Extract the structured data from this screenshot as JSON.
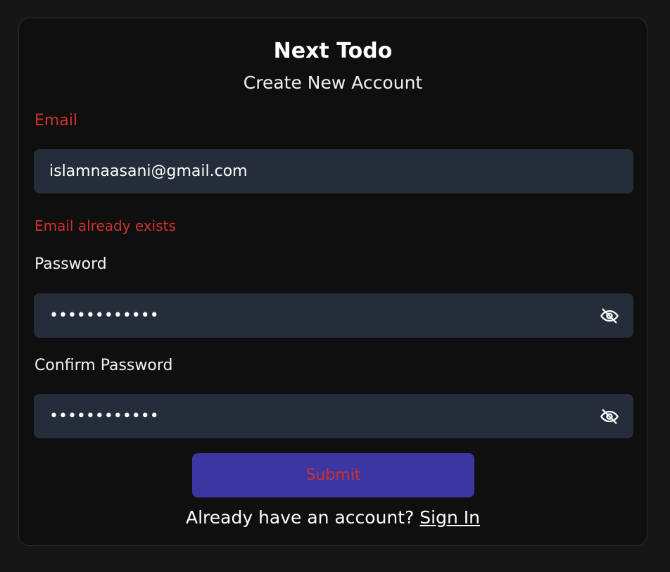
{
  "header": {
    "app_title": "Next Todo",
    "subtitle": "Create New Account"
  },
  "form": {
    "email": {
      "label": "Email",
      "value": "islamnaasani@gmail.com",
      "error": "Email already exists"
    },
    "password": {
      "label": "Password",
      "masked_value": "••••••••••••",
      "toggle_icon": "eye-off-icon"
    },
    "confirm_password": {
      "label": "Confirm Password",
      "masked_value": "••••••••••••",
      "toggle_icon": "eye-off-icon"
    },
    "submit_label": "Submit"
  },
  "footer": {
    "prompt": "Already have an account?",
    "link_label": "Sign In"
  },
  "colors": {
    "background": "#161616",
    "card": "#0f0f0f",
    "input": "#252d3b",
    "accent": "#3c36a3",
    "error": "#d0322c"
  }
}
